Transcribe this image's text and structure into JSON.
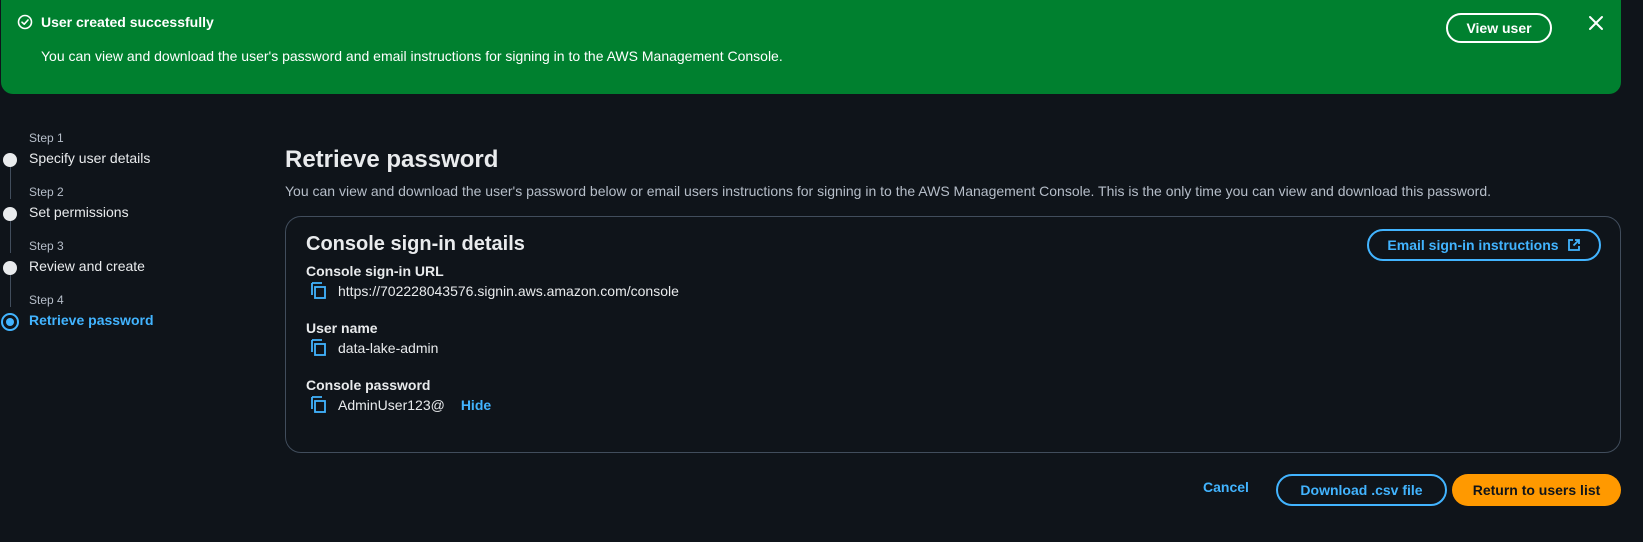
{
  "flash": {
    "title": "User created successfully",
    "message": "You can view and download the user's password and email instructions for signing in to the AWS Management Console.",
    "view_user_label": "View user",
    "icons": {
      "status": "check-circle-icon",
      "dismiss": "close-icon"
    },
    "color": "#00802f"
  },
  "steps": [
    {
      "number": "Step 1",
      "label": "Specify user details"
    },
    {
      "number": "Step 2",
      "label": "Set permissions"
    },
    {
      "number": "Step 3",
      "label": "Review and create"
    },
    {
      "number": "Step 4",
      "label": "Retrieve password",
      "active": true
    }
  ],
  "page": {
    "title": "Retrieve password",
    "description": "You can view and download the user's password below or email users instructions for signing in to the AWS Management Console. This is the only time you can view and download this password."
  },
  "card": {
    "title": "Console sign-in details",
    "email_button_label": "Email sign-in instructions",
    "fields": [
      {
        "label": "Console sign-in URL",
        "value": "https://702228043576.signin.aws.amazon.com/console"
      },
      {
        "label": "User name",
        "value": "data-lake-admin"
      },
      {
        "label": "Console password",
        "value": "AdminUser123@",
        "toggle_label": "Hide"
      }
    ]
  },
  "actions": {
    "cancel_label": "Cancel",
    "download_label": "Download .csv file",
    "return_label": "Return to users list"
  },
  "colors": {
    "accent": "#42b4ff",
    "primary_button": "#ff9900",
    "background": "#0f141a"
  }
}
